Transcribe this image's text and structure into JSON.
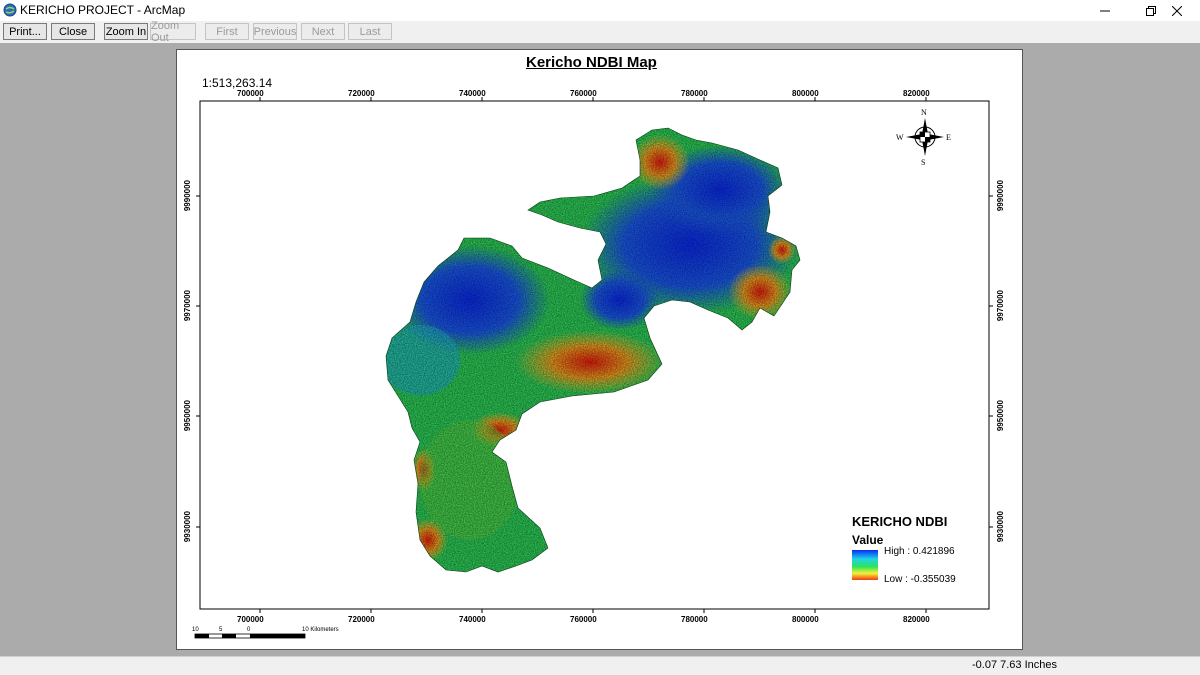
{
  "window": {
    "title": "KERICHO PROJECT - ArcMap"
  },
  "toolbar": {
    "print_label": "Print...",
    "close_label": "Close",
    "zoom_in_label": "Zoom In",
    "zoom_out_label": "Zoom Out",
    "first_label": "First",
    "previous_label": "Previous",
    "next_label": "Next",
    "last_label": "Last"
  },
  "map": {
    "title": "Kericho NDBI Map",
    "scale": "1:513,263.14",
    "x_ticks": [
      "700000",
      "720000",
      "740000",
      "760000",
      "780000",
      "800000",
      "820000"
    ],
    "y_ticks": [
      "9990000",
      "9970000",
      "9950000",
      "9930000"
    ],
    "north_arrow": {
      "n": "N",
      "s": "S",
      "e": "E",
      "w": "W"
    },
    "legend": {
      "title": "KERICHO NDBI",
      "subtitle": "Value",
      "high": "High : 0.421896",
      "low": "Low : -0.355039",
      "high_color": "#0a2cf5",
      "low_color": "#f23a10"
    },
    "scalebar": {
      "labels": [
        "10",
        "5",
        "0",
        "10 Kilometers"
      ]
    }
  },
  "status": {
    "coords": "-0.07  7.63 Inches"
  }
}
